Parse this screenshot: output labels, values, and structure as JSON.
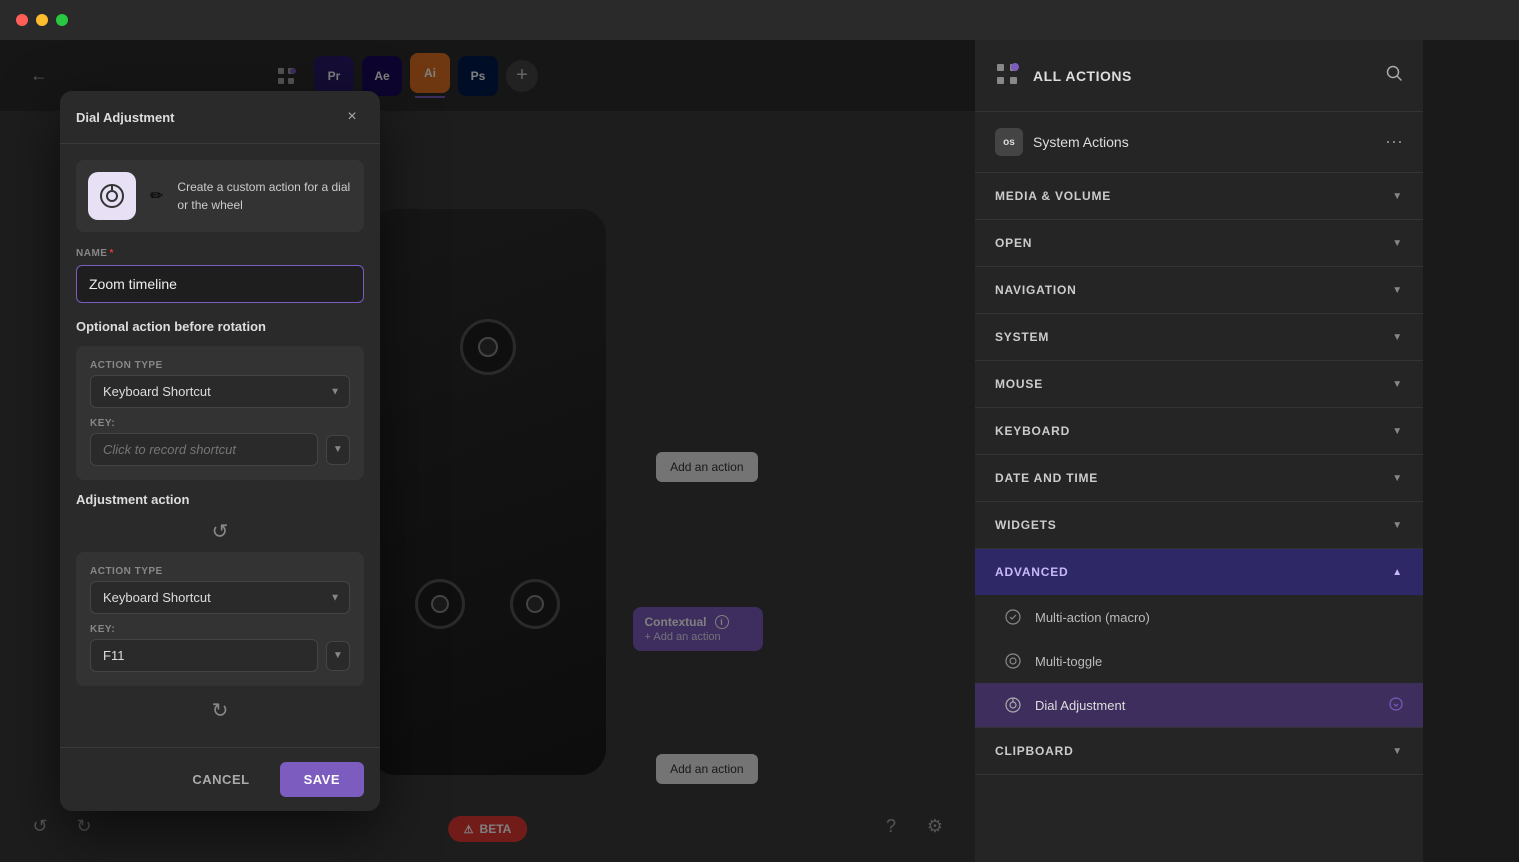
{
  "titlebar": {
    "traffic_lights": [
      "red",
      "yellow",
      "green"
    ]
  },
  "toolbar": {
    "back_icon": "←",
    "apps": [
      {
        "id": "grid",
        "label": "⊞",
        "type": "grid"
      },
      {
        "id": "pr",
        "label": "Pr",
        "type": "app",
        "color": "#2a1a6b",
        "has_underline": false
      },
      {
        "id": "ae",
        "label": "Ae",
        "type": "app",
        "color": "#1a0a5e",
        "has_underline": false
      },
      {
        "id": "ai",
        "label": "Ai",
        "type": "app",
        "color": "#ff7c00",
        "has_underline": false,
        "active": true
      },
      {
        "id": "ps",
        "label": "Ps",
        "type": "app",
        "color": "#001a4d",
        "has_underline": false
      }
    ],
    "add_label": "+"
  },
  "canvas": {
    "add_action_left": "Add an action",
    "add_action_right": "Add an action",
    "add_action_bottom_left": "Add an action",
    "add_action_bottom_right": "Add an action",
    "contextual_title": "Contextual",
    "contextual_sub": "+ Add an action"
  },
  "modal": {
    "title": "Dial Adjustment",
    "close_icon": "×",
    "description": "Create a custom action for a dial or the wheel",
    "name_label": "NAME",
    "name_required": "*",
    "name_value": "Zoom timeline",
    "optional_section_title": "Optional action before rotation",
    "optional_action_type_label": "ACTION TYPE",
    "optional_action_type_value": "Keyboard Shortcut",
    "optional_key_label": "KEY:",
    "optional_key_placeholder": "Click to record shortcut",
    "adjustment_section_title": "Adjustment action",
    "adjustment_action_type_label": "ACTION TYPE",
    "adjustment_action_type_value": "Keyboard Shortcut",
    "adjustment_key_label": "KEY:",
    "adjustment_key_value": "F11",
    "cancel_label": "CANCEL",
    "save_label": "SAVE"
  },
  "right_panel": {
    "all_actions_label": "ALL ACTIONS",
    "search_icon": "🔍",
    "system_actions_title": "System Actions",
    "system_actions_menu": "⋯",
    "sections": [
      {
        "id": "media-volume",
        "label": "MEDIA & VOLUME",
        "expanded": false
      },
      {
        "id": "open",
        "label": "OPEN",
        "expanded": false
      },
      {
        "id": "navigation",
        "label": "NAVIGATION",
        "expanded": false
      },
      {
        "id": "system",
        "label": "SYSTEM",
        "expanded": false
      },
      {
        "id": "mouse",
        "label": "MOUSE",
        "expanded": false
      },
      {
        "id": "keyboard",
        "label": "KEYBOARD",
        "expanded": false
      },
      {
        "id": "date-time",
        "label": "DATE AND TIME",
        "expanded": false
      },
      {
        "id": "widgets",
        "label": "WIDGETS",
        "expanded": false
      },
      {
        "id": "advanced",
        "label": "ADVANCED",
        "expanded": true
      },
      {
        "id": "clipboard",
        "label": "CLIPBOARD",
        "expanded": false
      }
    ],
    "advanced_items": [
      {
        "id": "multi-action",
        "label": "Multi-action (macro)",
        "icon": "⚙"
      },
      {
        "id": "multi-toggle",
        "label": "Multi-toggle",
        "icon": "⚙"
      },
      {
        "id": "dial-adjustment",
        "label": "Dial Adjustment",
        "icon": "⚙",
        "highlighted": true
      }
    ]
  },
  "bottom": {
    "beta_label": "BETA",
    "undo_icon": "↺",
    "redo_icon": "↻",
    "help_icon": "?",
    "settings_icon": "⚙"
  }
}
